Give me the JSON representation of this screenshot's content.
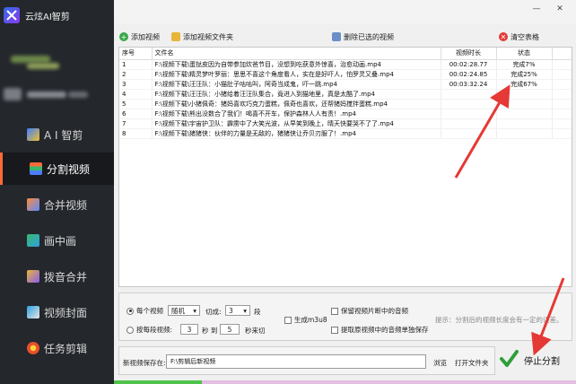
{
  "app": {
    "title": "云炫AI智剪"
  },
  "sidebar": {
    "items": [
      {
        "label": "A I 智剪",
        "color": "#4d7dff"
      },
      {
        "label": "分割视频",
        "color": "#ff6a3a"
      },
      {
        "label": "合并视频",
        "color": "#5a8cff"
      },
      {
        "label": "画中画",
        "color": "#38b86b"
      },
      {
        "label": "拨音合并",
        "color": "#e8b53a"
      },
      {
        "label": "视频封面",
        "color": "#2fa0e0"
      },
      {
        "label": "任务剪辑",
        "color": "#e6502d"
      }
    ]
  },
  "window": {
    "minimize": "—",
    "close": "✕"
  },
  "toolbar": {
    "add_video": "添加视频",
    "add_folder": "添加视频文件夹",
    "remove_selected": "删除已选的视频",
    "clear_table": "清空表格"
  },
  "table": {
    "headers": {
      "index": "序号",
      "filename": "文件名",
      "duration": "视频时长",
      "status": "状态"
    },
    "rows": [
      {
        "index": "1",
        "filename": "F:\\视频下载\\蛋挞皮因为自带参加炊爸节目，没想到吃获意外惊喜，治愈动画.mp4",
        "duration": "00:02:28.77",
        "status": "完成7%"
      },
      {
        "index": "2",
        "filename": "F:\\视频下载\\精灵梦叶罗丽：思思不喜这个角度看人，实在是好吓人，怕罗灵又叠.mp4",
        "duration": "00:02:24.85",
        "status": "完成25%"
      },
      {
        "index": "3",
        "filename": "F:\\视频下载\\汪汪队：小猫肚子咕咕叫，阿奇当成鬼，吓一跳.mp4",
        "duration": "00:03:32.24",
        "status": "完成67%"
      },
      {
        "index": "4",
        "filename": "F:\\视频下载\\汪汪队：小猪给着汪汪队集合，竟进入到猫地里，真是太酷了.mp4",
        "duration": "",
        "status": ""
      },
      {
        "index": "5",
        "filename": "F:\\视频下载\\小猪佩奇：猪妈喜欢巧克力蛋糕，佩奇也喜欢，还帮猪妈搅拌蛋糕.mp4",
        "duration": "",
        "status": ""
      },
      {
        "index": "6",
        "filename": "F:\\视频下载\\熊出没数合了我们！喝喜不开车，保护森林人人有责！.mp4",
        "duration": "",
        "status": ""
      },
      {
        "index": "7",
        "filename": "F:\\视频下载\\宇宙护卫队：霹雳中了大笑光波，从早笑到晚上，晴天快要哭不了了.mp4",
        "duration": "",
        "status": ""
      },
      {
        "index": "8",
        "filename": "F:\\视频下载\\猪猪侠：伙伴的力量是无敌的，猪猪侠让乔贝刃服了！.mp4",
        "duration": "",
        "status": ""
      }
    ]
  },
  "options": {
    "per_video_label": "每个视频",
    "mode_value": "随机",
    "cut_label": "切成:",
    "segments_value": "3",
    "segments_unit": "段",
    "by_duration_label": "按每段视频:",
    "from_value": "3",
    "sec_to": "秒 到",
    "to_value": "5",
    "sec_end": "秒来切",
    "generate_m3u8": "生成m3u8",
    "keep_audio": "保留视频片断中的音频",
    "extract_audio": "提取原视频中的音频单独保存",
    "hint": "提示：分割后的视频长度会有一定的误差。"
  },
  "save": {
    "label": "新视频保存在:",
    "path": "F:\\剪辑后新视频",
    "browse": "浏览",
    "open_folder": "打开文件夹"
  },
  "stop": {
    "label": "停止分割"
  },
  "progress": {
    "fraction": 0.19
  },
  "colors": {
    "sidebar_bg": "#24272c",
    "accent_red": "#e53935",
    "progress_fill": "#4fc34a",
    "progress_bg": "#e2bfe3"
  }
}
